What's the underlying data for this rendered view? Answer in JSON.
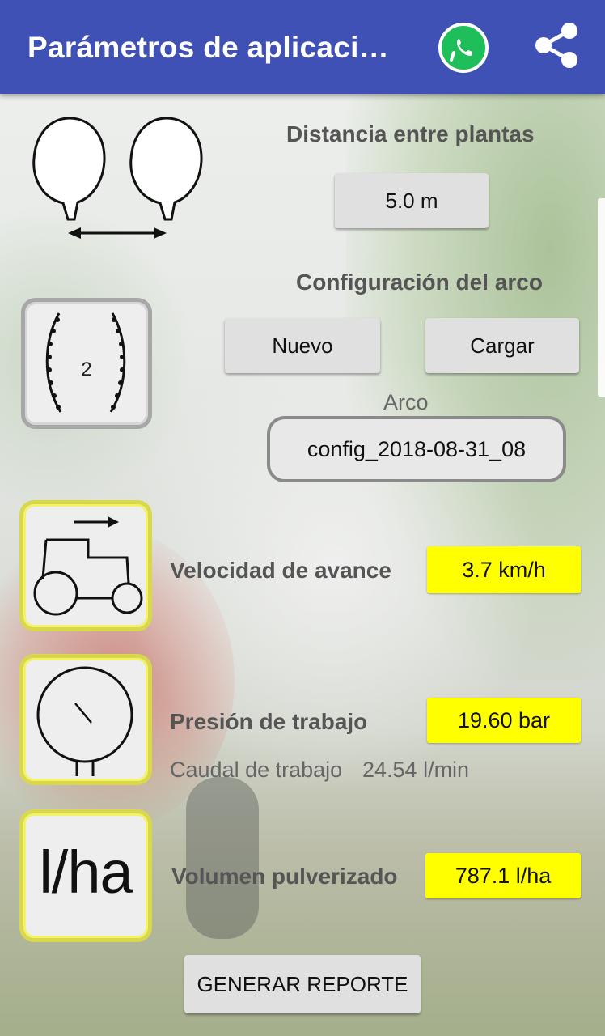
{
  "appbar": {
    "title": "Parámetros de aplicaci…",
    "color": "#3f51b5",
    "icons": [
      "whatsapp-icon",
      "share-icon"
    ]
  },
  "plant_distance": {
    "label": "Distancia entre plantas",
    "value": "5.0 m"
  },
  "arc_config": {
    "label": "Configuración del arco",
    "new_button": "Nuevo",
    "load_button": "Cargar",
    "arc_label": "Arco",
    "arc_value": "config_2018-08-31_08",
    "nozzle_count": "2"
  },
  "speed": {
    "label": "Velocidad de avance",
    "value": "3.7 km/h"
  },
  "pressure": {
    "label": "Presión de trabajo",
    "value": "19.60 bar",
    "flow_label": "Caudal de trabajo",
    "flow_value": "24.54 l/min"
  },
  "volume": {
    "label": "Volumen pulverizado",
    "value": "787.1 l/ha",
    "icon_text": "l/ha"
  },
  "report_button": "GENERAR REPORTE",
  "colors": {
    "value_highlight": "#ffff00",
    "whatsapp": "#1ebe5a"
  }
}
